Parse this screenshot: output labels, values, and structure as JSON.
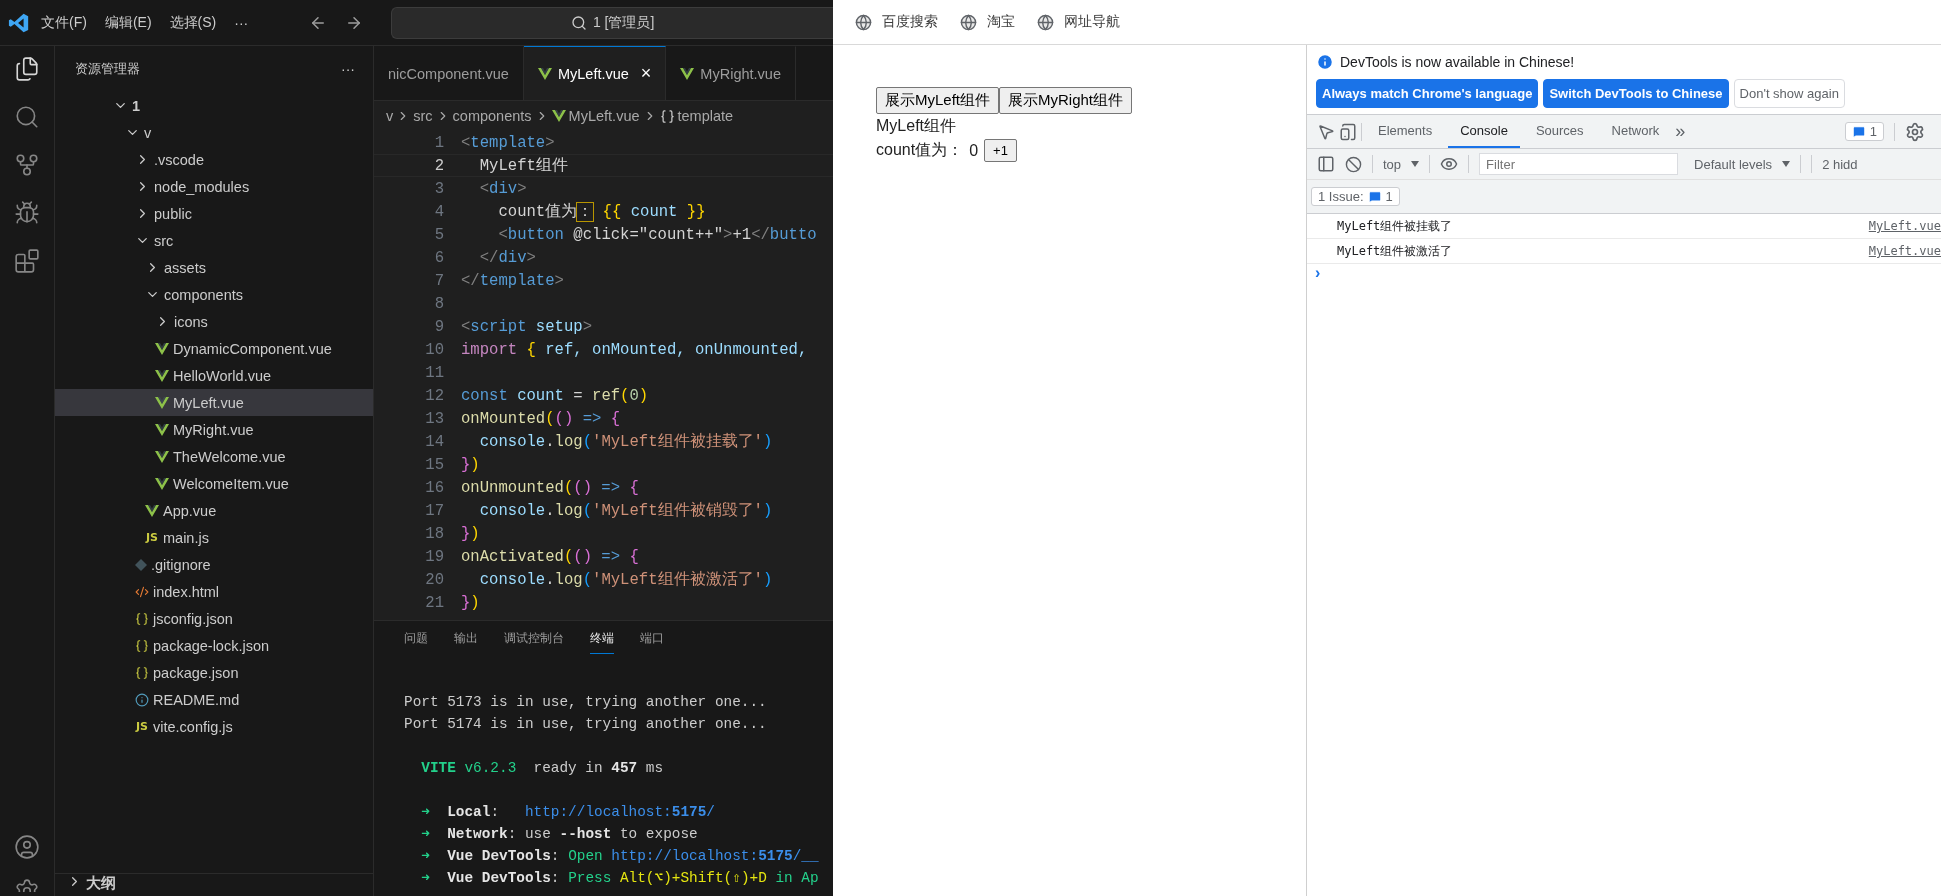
{
  "vscode": {
    "menu": [
      "文件(F)",
      "编辑(E)",
      "选择(S)",
      "···"
    ],
    "command_center": {
      "text": "1 [管理员]"
    },
    "activity_bar": [
      {
        "kind": "files",
        "selected": true
      },
      {
        "kind": "search",
        "selected": false
      },
      {
        "kind": "git",
        "selected": false
      },
      {
        "kind": "debug",
        "selected": false
      },
      {
        "kind": "extensions",
        "selected": false
      }
    ],
    "explorer": {
      "title": "资源管理器",
      "more": "···",
      "tree": [
        {
          "label": "1",
          "kind": "folder",
          "expanded": true,
          "selected": false,
          "children": [
            {
              "label": "v",
              "kind": "folder",
              "expanded": true,
              "selected": false,
              "children": [
                {
                  "label": ".vscode",
                  "kind": "folder",
                  "expanded": false,
                  "selected": false
                },
                {
                  "label": "node_modules",
                  "kind": "folder",
                  "expanded": false,
                  "selected": false
                },
                {
                  "label": "public",
                  "kind": "folder",
                  "expanded": false,
                  "selected": false
                },
                {
                  "label": "src",
                  "kind": "folder",
                  "expanded": true,
                  "selected": false,
                  "children": [
                    {
                      "label": "assets",
                      "kind": "folder",
                      "expanded": false,
                      "selected": false
                    },
                    {
                      "label": "components",
                      "kind": "folder",
                      "expanded": true,
                      "selected": false,
                      "children": [
                        {
                          "label": "icons",
                          "kind": "folder",
                          "expanded": false,
                          "selected": false
                        },
                        {
                          "label": "DynamicComponent.vue",
                          "kind": "vue",
                          "selected": false
                        },
                        {
                          "label": "HelloWorld.vue",
                          "kind": "vue",
                          "selected": false
                        },
                        {
                          "label": "MyLeft.vue",
                          "kind": "vue",
                          "selected": true
                        },
                        {
                          "label": "MyRight.vue",
                          "kind": "vue",
                          "selected": false
                        },
                        {
                          "label": "TheWelcome.vue",
                          "kind": "vue",
                          "selected": false
                        },
                        {
                          "label": "WelcomeItem.vue",
                          "kind": "vue",
                          "selected": false
                        }
                      ]
                    },
                    {
                      "label": "App.vue",
                      "kind": "vue",
                      "selected": false
                    },
                    {
                      "label": "main.js",
                      "kind": "js",
                      "icon_text": "JS",
                      "selected": false
                    }
                  ]
                },
                {
                  "label": ".gitignore",
                  "kind": "git",
                  "selected": false
                },
                {
                  "label": "index.html",
                  "kind": "html",
                  "selected": false
                },
                {
                  "label": "jsconfig.json",
                  "kind": "json",
                  "selected": false
                },
                {
                  "label": "package-lock.json",
                  "kind": "json",
                  "selected": false
                },
                {
                  "label": "package.json",
                  "kind": "json",
                  "selected": false
                },
                {
                  "label": "README.md",
                  "kind": "info",
                  "selected": false
                },
                {
                  "label": "vite.config.js",
                  "kind": "js",
                  "icon_text": "JS",
                  "selected": false
                }
              ]
            }
          ]
        }
      ],
      "outline": {
        "label": "大纲",
        "expanded": false
      }
    },
    "editor_tabs": [
      {
        "label": "nicComponent.vue",
        "icon": false,
        "selected": false
      },
      {
        "label": "MyLeft.vue",
        "icon": true,
        "selected": true,
        "close": "×"
      },
      {
        "label": "MyRight.vue",
        "icon": true,
        "selected": false
      }
    ],
    "breadcrumb": [
      {
        "kind": "text",
        "text": "v"
      },
      {
        "kind": "text",
        "text": "src"
      },
      {
        "kind": "text",
        "text": "components"
      },
      {
        "kind": "vue",
        "text": "MyLeft.vue"
      },
      {
        "kind": "symbol",
        "text": "template"
      }
    ],
    "code": [
      {
        "number": "1",
        "current": false,
        "tokens": [
          {
            "kind": "punct",
            "text": "<"
          },
          {
            "kind": "tag",
            "text": "template"
          },
          {
            "kind": "punct",
            "text": ">"
          }
        ]
      },
      {
        "number": "2",
        "current": true,
        "tokens": [
          {
            "kind": "text",
            "text": "  MyLeft组件"
          }
        ]
      },
      {
        "number": "3",
        "current": false,
        "tokens": [
          {
            "kind": "punct",
            "text": "  <"
          },
          {
            "kind": "tag",
            "text": "div"
          },
          {
            "kind": "punct",
            "text": ">"
          }
        ]
      },
      {
        "number": "4",
        "current": false,
        "tokens": [
          {
            "kind": "text",
            "text": "    count值为"
          },
          {
            "kind": "boxed",
            "text": "："
          },
          {
            "kind": "brace1",
            "text": " {{"
          },
          {
            "kind": "var",
            "text": " count "
          },
          {
            "kind": "brace1",
            "text": "}}"
          }
        ]
      },
      {
        "number": "5",
        "current": false,
        "tokens": [
          {
            "kind": "punct",
            "text": "    <"
          },
          {
            "kind": "tag",
            "text": "button"
          },
          {
            "kind": "text",
            "text": " @click=\"count++\""
          },
          {
            "kind": "punct",
            "text": ">"
          },
          {
            "kind": "text",
            "text": "+1"
          },
          {
            "kind": "punct",
            "text": "</"
          },
          {
            "kind": "tag",
            "text": "butto"
          }
        ]
      },
      {
        "number": "6",
        "current": false,
        "tokens": [
          {
            "kind": "punct",
            "text": "  </"
          },
          {
            "kind": "tag",
            "text": "div"
          },
          {
            "kind": "punct",
            "text": ">"
          }
        ]
      },
      {
        "number": "7",
        "current": false,
        "tokens": [
          {
            "kind": "punct",
            "text": "</"
          },
          {
            "kind": "tag",
            "text": "template"
          },
          {
            "kind": "punct",
            "text": ">"
          }
        ]
      },
      {
        "number": "8",
        "current": false
      },
      {
        "number": "9",
        "current": false,
        "tokens": [
          {
            "kind": "punct",
            "text": "<"
          },
          {
            "kind": "tag",
            "text": "script"
          },
          {
            "kind": "var",
            "text": " setup"
          },
          {
            "kind": "punct",
            "text": ">"
          }
        ]
      },
      {
        "number": "10",
        "current": false,
        "tokens": [
          {
            "kind": "keyword",
            "text": "import"
          },
          {
            "kind": "brace1",
            "text": " {"
          },
          {
            "kind": "var",
            "text": " ref, onMounted, onUnmounted,"
          }
        ]
      },
      {
        "number": "11",
        "current": false
      },
      {
        "number": "12",
        "current": false,
        "tokens": [
          {
            "kind": "const",
            "text": "const"
          },
          {
            "kind": "var",
            "text": " count"
          },
          {
            "kind": "text",
            "text": " = "
          },
          {
            "kind": "func",
            "text": "ref"
          },
          {
            "kind": "brace1",
            "text": "("
          },
          {
            "kind": "number",
            "text": "0"
          },
          {
            "kind": "brace1",
            "text": ")"
          }
        ]
      },
      {
        "number": "13",
        "current": false,
        "tokens": [
          {
            "kind": "func",
            "text": "onMounted"
          },
          {
            "kind": "brace1",
            "text": "("
          },
          {
            "kind": "brace2",
            "text": "()"
          },
          {
            "kind": "const",
            "text": " => "
          },
          {
            "kind": "brace2",
            "text": "{"
          }
        ]
      },
      {
        "number": "14",
        "current": false,
        "tokens": [
          {
            "kind": "var",
            "text": "  console"
          },
          {
            "kind": "text",
            "text": "."
          },
          {
            "kind": "func",
            "text": "log"
          },
          {
            "kind": "brace3",
            "text": "("
          },
          {
            "kind": "string",
            "text": "'MyLeft组件被挂载了'"
          },
          {
            "kind": "brace3",
            "text": ")"
          }
        ]
      },
      {
        "number": "15",
        "current": false,
        "tokens": [
          {
            "kind": "brace2",
            "text": "}"
          },
          {
            "kind": "brace1",
            "text": ")"
          }
        ]
      },
      {
        "number": "16",
        "current": false,
        "tokens": [
          {
            "kind": "func",
            "text": "onUnmounted"
          },
          {
            "kind": "brace1",
            "text": "("
          },
          {
            "kind": "brace2",
            "text": "()"
          },
          {
            "kind": "const",
            "text": " => "
          },
          {
            "kind": "brace2",
            "text": "{"
          }
        ]
      },
      {
        "number": "17",
        "current": false,
        "tokens": [
          {
            "kind": "var",
            "text": "  console"
          },
          {
            "kind": "text",
            "text": "."
          },
          {
            "kind": "func",
            "text": "log"
          },
          {
            "kind": "brace3",
            "text": "("
          },
          {
            "kind": "string",
            "text": "'MyLeft组件被销毁了'"
          },
          {
            "kind": "brace3",
            "text": ")"
          }
        ]
      },
      {
        "number": "18",
        "current": false,
        "tokens": [
          {
            "kind": "brace2",
            "text": "}"
          },
          {
            "kind": "brace1",
            "text": ")"
          }
        ]
      },
      {
        "number": "19",
        "current": false,
        "tokens": [
          {
            "kind": "func",
            "text": "onActivated"
          },
          {
            "kind": "brace1",
            "text": "("
          },
          {
            "kind": "brace2",
            "text": "()"
          },
          {
            "kind": "const",
            "text": " => "
          },
          {
            "kind": "brace2",
            "text": "{"
          }
        ]
      },
      {
        "number": "20",
        "current": false,
        "tokens": [
          {
            "kind": "var",
            "text": "  console"
          },
          {
            "kind": "text",
            "text": "."
          },
          {
            "kind": "func",
            "text": "log"
          },
          {
            "kind": "brace3",
            "text": "("
          },
          {
            "kind": "string",
            "text": "'MyLeft组件被激活了'"
          },
          {
            "kind": "brace3",
            "text": ")"
          }
        ]
      },
      {
        "number": "21",
        "current": false,
        "tokens": [
          {
            "kind": "brace2",
            "text": "}"
          },
          {
            "kind": "brace1",
            "text": ")"
          }
        ]
      }
    ],
    "panel_tabs": [
      {
        "label": "问题",
        "selected": false
      },
      {
        "label": "输出",
        "selected": false
      },
      {
        "label": "调试控制台",
        "selected": false
      },
      {
        "label": "终端",
        "selected": true
      },
      {
        "label": "端口",
        "selected": false
      }
    ],
    "terminal": [
      {
        "kind": "blank"
      },
      {
        "kind": "text",
        "tokens": [
          {
            "kind": "plain",
            "text": "Port 5173 is in use, trying another one..."
          }
        ]
      },
      {
        "kind": "text",
        "tokens": [
          {
            "kind": "plain",
            "text": "Port 5174 is in use, trying another one..."
          }
        ]
      },
      {
        "kind": "blank"
      },
      {
        "kind": "text",
        "tokens": [
          {
            "kind": "greenbold",
            "text": "  VITE"
          },
          {
            "kind": "green",
            "text": " v6.2.3"
          },
          {
            "kind": "plain",
            "text": "  ready in "
          },
          {
            "kind": "bold",
            "text": "457"
          },
          {
            "kind": "plain",
            "text": " ms"
          }
        ]
      },
      {
        "kind": "blank"
      },
      {
        "kind": "text",
        "tokens": [
          {
            "kind": "green",
            "text": "  ➜"
          },
          {
            "kind": "bold",
            "text": "  Local"
          },
          {
            "kind": "plain",
            "text": ":   "
          },
          {
            "kind": "link",
            "text": "http://localhost:"
          },
          {
            "kind": "linkbold",
            "text": "5175"
          },
          {
            "kind": "link",
            "text": "/"
          }
        ]
      },
      {
        "kind": "text",
        "tokens": [
          {
            "kind": "green",
            "text": "  ➜"
          },
          {
            "kind": "bold",
            "text": "  Network"
          },
          {
            "kind": "plain",
            "text": ": use "
          },
          {
            "kind": "bold",
            "text": "--host"
          },
          {
            "kind": "plain",
            "text": " to expose"
          }
        ]
      },
      {
        "kind": "text",
        "tokens": [
          {
            "kind": "green",
            "text": "  ➜"
          },
          {
            "kind": "bold",
            "text": "  Vue DevTools"
          },
          {
            "kind": "plain",
            "text": ": "
          },
          {
            "kind": "green",
            "text": "Open "
          },
          {
            "kind": "link",
            "text": "http://localhost:"
          },
          {
            "kind": "linkbold",
            "text": "5175"
          },
          {
            "kind": "link",
            "text": "/__"
          }
        ]
      },
      {
        "kind": "text",
        "tokens": [
          {
            "kind": "green",
            "text": "  ➜"
          },
          {
            "kind": "bold",
            "text": "  Vue DevTools"
          },
          {
            "kind": "plain",
            "text": ": "
          },
          {
            "kind": "green",
            "text": "Press "
          },
          {
            "kind": "yellow",
            "text": "Alt(⌥)+Shift(⇧)+D"
          },
          {
            "kind": "green",
            "text": " in Ap"
          }
        ]
      }
    ]
  },
  "browser": {
    "bookmarks": [
      "百度搜索",
      "淘宝",
      "网址导航"
    ],
    "page": {
      "buttons": [
        "展示MyLeft组件",
        "展示MyRight组件"
      ],
      "component_title": "MyLeft组件",
      "count_label": "count值为：",
      "count_value": "0",
      "increment": "+1"
    },
    "devtools": {
      "banner": {
        "text": "DevTools is now available in Chinese!",
        "buttons": [
          {
            "label": "Always match Chrome's language",
            "primary": true
          },
          {
            "label": "Switch DevTools to Chinese",
            "primary": true
          },
          {
            "label": "Don't show again",
            "primary": false
          }
        ]
      },
      "tabs": [
        {
          "label": "Elements",
          "selected": false
        },
        {
          "label": "Console",
          "selected": true
        },
        {
          "label": "Sources",
          "selected": false
        },
        {
          "label": "Network",
          "selected": false
        }
      ],
      "more_tabs": "»",
      "issues_badge": "1",
      "context": "top",
      "filter": {
        "placeholder": "Filter"
      },
      "levels": "Default levels",
      "hidden": "2 hidd",
      "issue_row": {
        "label": "1 Issue:",
        "count": "1"
      },
      "messages": [
        {
          "text": "MyLeft组件被挂载了",
          "source": "MyLeft.vue"
        },
        {
          "text": "MyLeft组件被激活了",
          "source": "MyLeft.vue"
        }
      ],
      "prompt": "›"
    }
  }
}
